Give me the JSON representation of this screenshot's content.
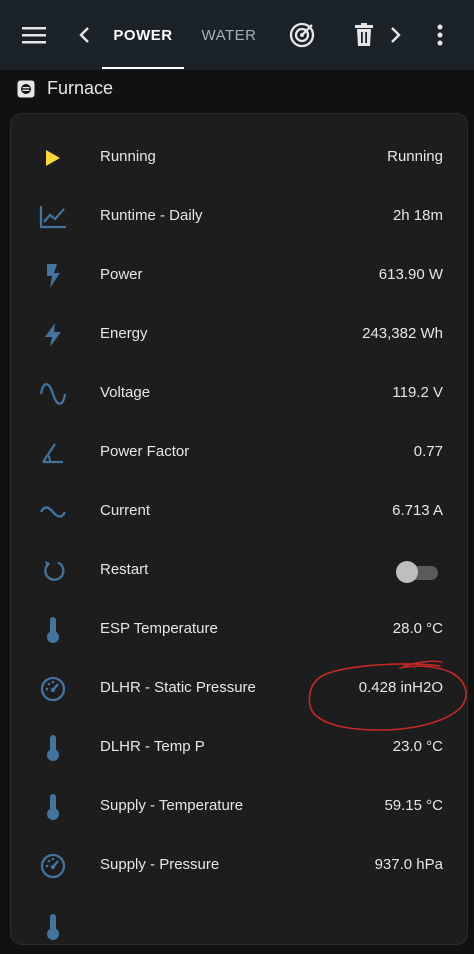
{
  "toolbar": {
    "menu_icon": "menu-icon",
    "prev_icon": "chevron-left-icon",
    "tabs": [
      {
        "label": "POWER",
        "active": true
      },
      {
        "label": "WATER",
        "active": false
      }
    ],
    "radar_icon": "radar-icon",
    "trash_icon": "trash-icon",
    "next_icon": "chevron-right-icon",
    "more_icon": "more-vertical-icon"
  },
  "section": {
    "title": "Furnace",
    "icon": "furnace-icon"
  },
  "entities": [
    {
      "label": "Running",
      "value": "Running",
      "icon": "play-icon"
    },
    {
      "label": "Runtime - Daily",
      "value": "2h 18m",
      "icon": "chart-line-icon"
    },
    {
      "label": "Power",
      "value": "613.90 W",
      "icon": "flash-icon"
    },
    {
      "label": "Energy",
      "value": "243,382 Wh",
      "icon": "lightning-icon"
    },
    {
      "label": "Voltage",
      "value": "119.2 V",
      "icon": "sine-wave-icon"
    },
    {
      "label": "Power Factor",
      "value": "0.77",
      "icon": "angle-icon"
    },
    {
      "label": "Current",
      "value": "6.713 A",
      "icon": "current-ac-icon"
    },
    {
      "label": "Restart",
      "value": "",
      "icon": "restart-icon",
      "toggle_on": false
    },
    {
      "label": "ESP Temperature",
      "value": "28.0 °C",
      "icon": "thermometer-icon"
    },
    {
      "label": "DLHR - Static Pressure",
      "value": "0.428 inH2O",
      "icon": "gauge-icon"
    },
    {
      "label": "DLHR - Temp P",
      "value": "23.0 °C",
      "icon": "thermometer-icon"
    },
    {
      "label": "Supply - Temperature",
      "value": "59.15 °C",
      "icon": "thermometer-icon"
    },
    {
      "label": "Supply - Pressure",
      "value": "937.0 hPa",
      "icon": "gauge-icon"
    }
  ],
  "colors": {
    "accent": "#fdd835",
    "icon": "#44739e",
    "annotation": "#c62828"
  }
}
